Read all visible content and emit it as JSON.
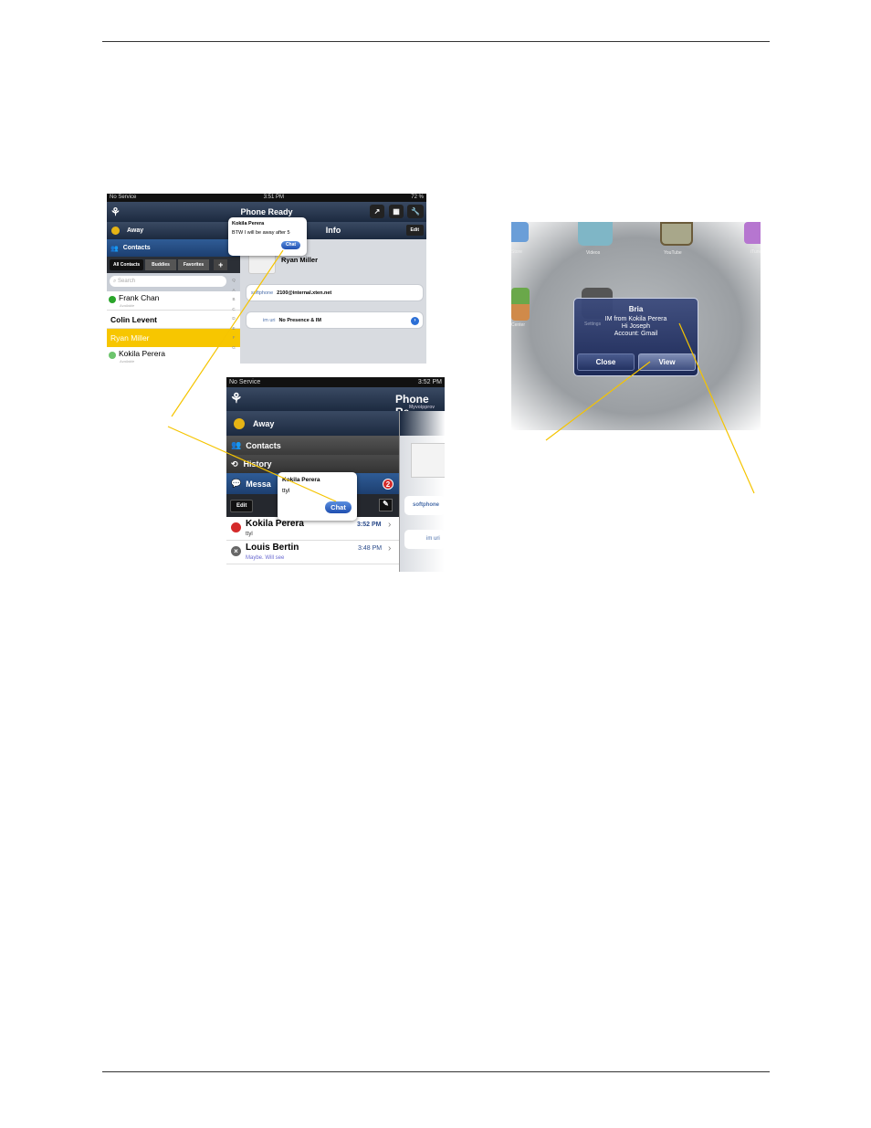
{
  "shot1": {
    "status": {
      "carrier": "No Service",
      "time": "3:51 PM",
      "battery": "72 %"
    },
    "title": "Phone Ready",
    "presence": "Away",
    "contacts_label": "Contacts",
    "tabs": [
      "All Contacts",
      "Buddies",
      "Favorites"
    ],
    "add": "+",
    "search_placeholder": "Search",
    "index": [
      "Q",
      "A",
      "B",
      "C",
      "D",
      "E",
      "F",
      "G"
    ],
    "contacts": [
      {
        "name": "Frank Chan",
        "status": "Available"
      },
      {
        "name": "Colin Levent",
        "status": ""
      },
      {
        "name": "Ryan Miller",
        "status": ""
      },
      {
        "name": "Kokila Perera",
        "status": "Available"
      }
    ],
    "info_title": "Info",
    "edit": "Edit",
    "contact_name": "Ryan Miller",
    "fields": [
      {
        "label": "softphone",
        "value": "2100@internal.xten.net"
      },
      {
        "label": "im uri",
        "value": "No Presence & IM"
      }
    ],
    "popup": {
      "from": "Kokila Perera",
      "message": "BTW I will be away after 5",
      "button": "Chat"
    }
  },
  "shot2": {
    "status": {
      "carrier": "No Service",
      "time": "3:52 PM"
    },
    "title": "Phone Re",
    "subtitle": "Myvoipprov",
    "menu": [
      "Away",
      "Contacts",
      "History",
      "Messa"
    ],
    "badge": "2",
    "edit": "Edit",
    "messages": [
      {
        "name": "Kokila Perera",
        "preview": "ttyl",
        "time": "3:52 PM"
      },
      {
        "name": "Louis Bertin",
        "preview": "Maybe. Will see",
        "time": "3:48 PM"
      }
    ],
    "right_fields": [
      "softphone",
      "im uri"
    ],
    "popup": {
      "from": "Kokila Perera",
      "message": "ttyl",
      "button": "Chat"
    }
  },
  "shot3": {
    "icons": [
      "Store",
      "Videos",
      "YouTube",
      "iTunes",
      "Center",
      "Settings"
    ],
    "alert": {
      "title": "Bria",
      "line1": "IM from Kokila Perera",
      "line2": "Hi Joseph",
      "line3": "Account: Gmail",
      "close": "Close",
      "view": "View"
    }
  },
  "colors": {
    "callout": "#f5c400",
    "selected": "#f7c600",
    "navy": "#1c2a40",
    "alert": "#1f2d5c"
  }
}
